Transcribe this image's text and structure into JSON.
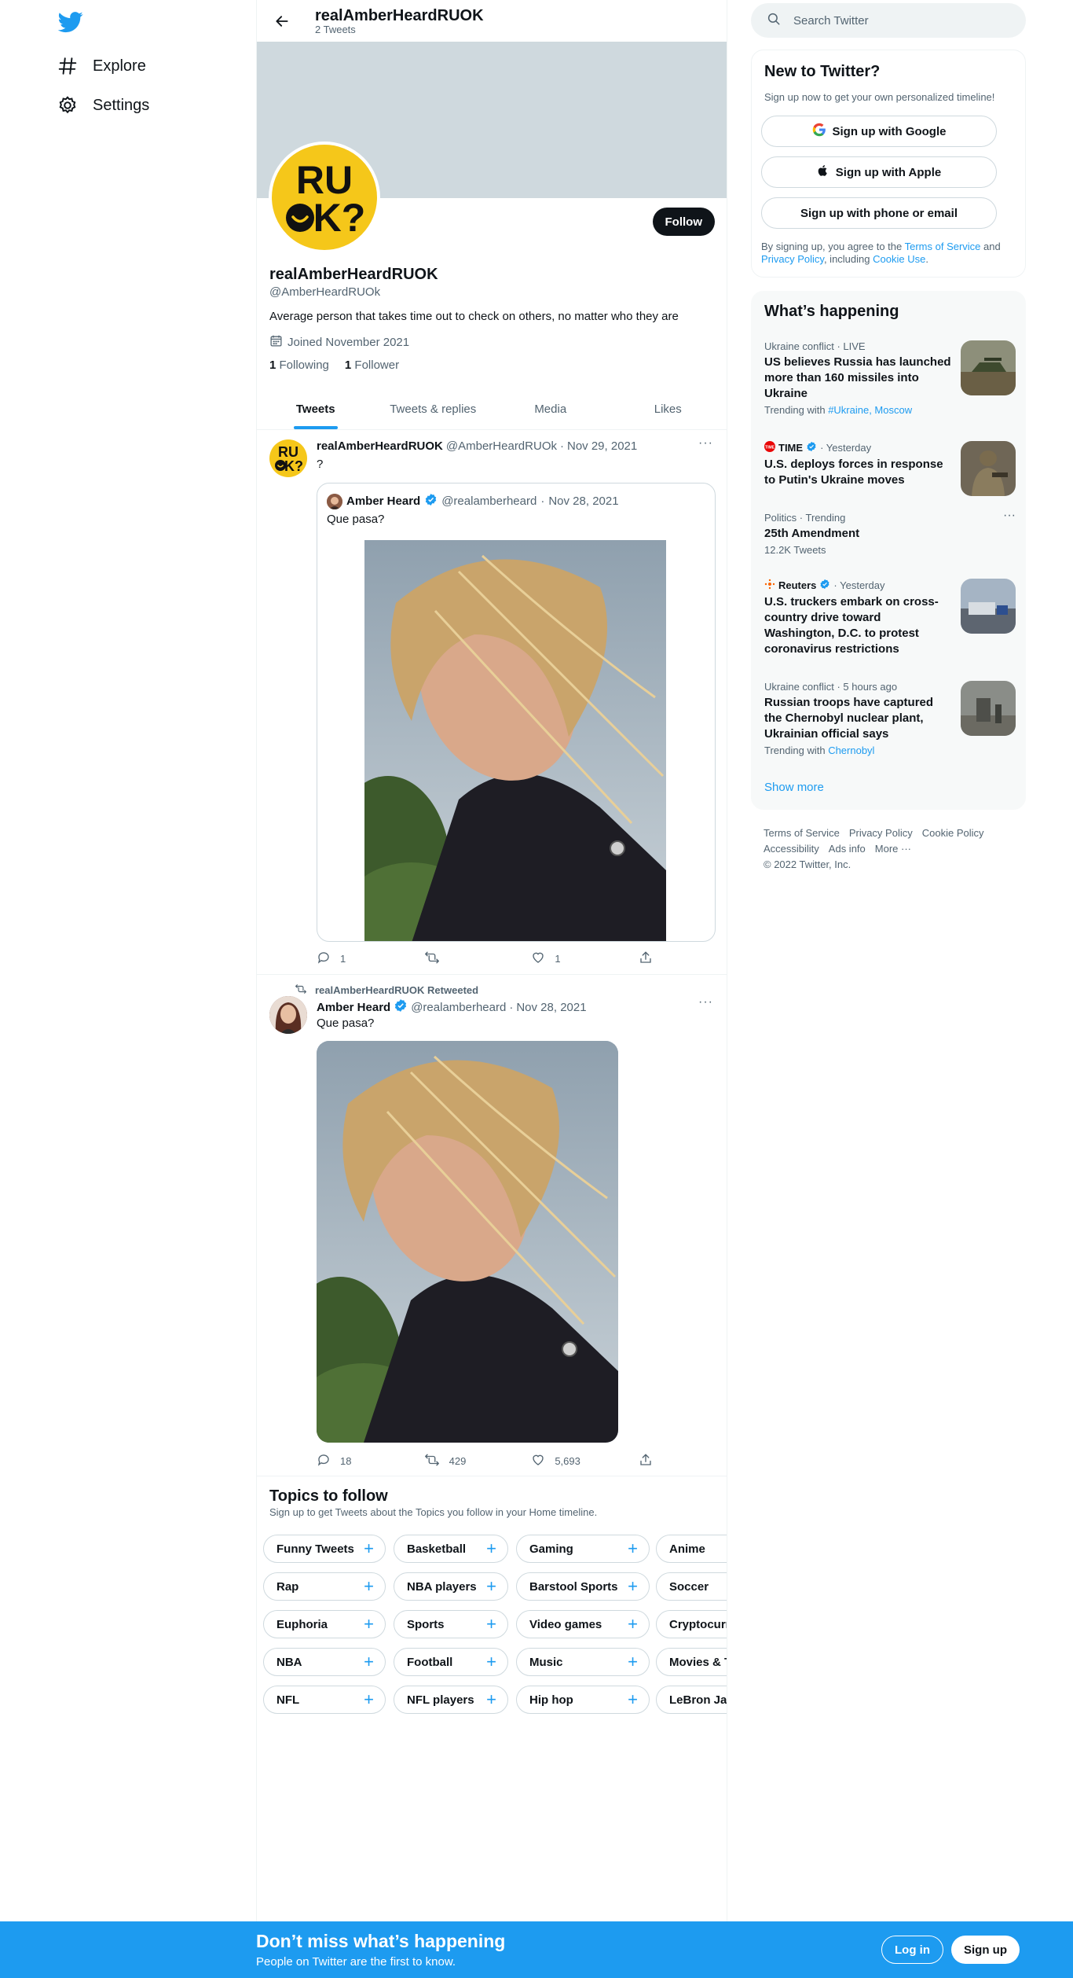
{
  "nav": {
    "items": [
      {
        "label": "Explore",
        "icon": "hashtag-icon"
      },
      {
        "label": "Settings",
        "icon": "gear-icon"
      }
    ]
  },
  "header": {
    "name": "realAmberHeardRUOK",
    "tweet_count": "2 Tweets"
  },
  "profile": {
    "avatar_text_top": "RU",
    "avatar_text_bottom": "K?",
    "follow_label": "Follow",
    "name": "realAmberHeardRUOK",
    "handle": "@AmberHeardRUOk",
    "bio": "Average person that takes time out to check on others, no matter who they are",
    "joined": "Joined November 2021",
    "following_count": "1",
    "following_label": "Following",
    "followers_count": "1",
    "followers_label": "Follower"
  },
  "tabs": [
    {
      "label": "Tweets",
      "active": true
    },
    {
      "label": "Tweets & replies"
    },
    {
      "label": "Media"
    },
    {
      "label": "Likes"
    }
  ],
  "tweet1": {
    "name": "realAmberHeardRUOK",
    "handle": "@AmberHeardRUOk",
    "date": "Nov 29, 2021",
    "text": "?",
    "quote": {
      "name": "Amber Heard",
      "handle": "@realamberheard",
      "date": "Nov 28, 2021",
      "text": "Que pasa?"
    },
    "replies": "1",
    "retweets": "",
    "likes": "1"
  },
  "tweet2": {
    "retweeted_by": "realAmberHeardRUOK Retweeted",
    "name": "Amber Heard",
    "handle": "@realamberheard",
    "date": "Nov 28, 2021",
    "text": "Que pasa?",
    "replies": "18",
    "retweets": "429",
    "likes": "5,693"
  },
  "topics": {
    "title": "Topics to follow",
    "subtitle": "Sign up to get Tweets about the Topics you follow in your Home timeline.",
    "rows": [
      [
        "Funny Tweets",
        "Basketball",
        "Gaming",
        "Anime"
      ],
      [
        "Rap",
        "NBA players",
        "Barstool Sports",
        "Soccer"
      ],
      [
        "Euphoria",
        "Sports",
        "Video games",
        "Cryptocurrency"
      ],
      [
        "NBA",
        "Football",
        "Music",
        "Movies & TV"
      ],
      [
        "NFL",
        "NFL players",
        "Hip hop",
        "LeBron James"
      ]
    ]
  },
  "search": {
    "placeholder": "Search Twitter"
  },
  "new_to_twitter": {
    "title": "New to Twitter?",
    "subtitle": "Sign up now to get your own personalized timeline!",
    "google": "Sign up with Google",
    "apple": "Sign up with Apple",
    "phone": "Sign up with phone or email",
    "legal_pre": "By signing up, you agree to the ",
    "tos": "Terms of Service",
    "legal_and": " and ",
    "privacy": "Privacy Policy",
    "legal_mid": ", including ",
    "cookie": "Cookie Use",
    "legal_end": "."
  },
  "happening": {
    "title": "What’s happening",
    "trends": [
      {
        "meta": "Ukraine conflict · LIVE",
        "title": "US believes Russia has launched more than 160 missiles into Ukraine",
        "with_label": "Trending with",
        "with_tags": "#Ukraine, Moscow"
      },
      {
        "source": "TIME",
        "meta": "· Yesterday",
        "title": "U.S. deploys forces in response to Putin's Ukraine moves"
      },
      {
        "meta": "Politics · Trending",
        "title": "25th Amendment",
        "count": "12.2K Tweets"
      },
      {
        "source": "Reuters",
        "meta": "· Yesterday",
        "title": "U.S. truckers embark on cross-country drive toward Washington, D.C. to protest coronavirus restrictions"
      },
      {
        "meta": "Ukraine conflict · 5 hours ago",
        "title": "Russian troops have captured the Chernobyl nuclear plant, Ukrainian official says",
        "with_label": "Trending with",
        "with_tags": "Chernobyl"
      }
    ],
    "show_more": "Show more"
  },
  "footer": {
    "links": [
      "Terms of Service",
      "Privacy Policy",
      "Cookie Policy",
      "Accessibility",
      "Ads info",
      "More ···"
    ],
    "copyright": "© 2022 Twitter, Inc."
  },
  "bottom_bar": {
    "title": "Don’t miss what’s happening",
    "subtitle": "People on Twitter are the first to know.",
    "login": "Log in",
    "signup": "Sign up"
  },
  "colors": {
    "accent": "#1d9bf0",
    "text": "#0f1419",
    "muted": "#536471",
    "banner": "#cfd9de",
    "avatar_bg": "#f5c71a"
  }
}
